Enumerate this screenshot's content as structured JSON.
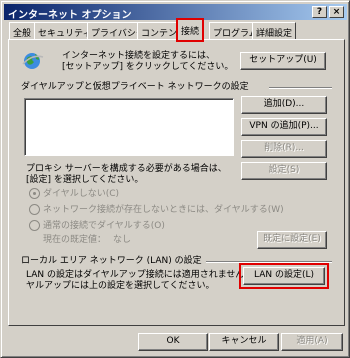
{
  "window": {
    "title": "インターネット オプション",
    "help_label": "?",
    "close_label": "×"
  },
  "tabs": [
    {
      "label": "全般"
    },
    {
      "label": "セキュリティ"
    },
    {
      "label": "プライバシー"
    },
    {
      "label": "コンテンツ"
    },
    {
      "label": "接続",
      "active": true
    },
    {
      "label": "プログラム"
    },
    {
      "label": "詳細設定"
    }
  ],
  "setup": {
    "text_line1": "インターネット接続を設定するには、",
    "text_line2": "[セットアップ] をクリックしてください。",
    "button_label": "セットアップ(U)"
  },
  "dialup": {
    "section_label": "ダイヤルアップと仮想プライベート ネットワークの設定",
    "add_label": "追加(D)...",
    "vpn_label": "VPN の追加(P)...",
    "delete_label": "削除(R)...",
    "settings_label": "設定(S)",
    "proxy_line1": "プロキシ サーバーを構成する必要がある場合は、",
    "proxy_line2": "[設定] を選択してください。",
    "radio_never": "ダイヤルしない(C)",
    "radio_when_none": "ネットワーク接続が存在しないときには、ダイヤルする(W)",
    "radio_always": "通常の接続でダイヤルする(O)",
    "current_default_label": "現在の既定値：",
    "current_default_value": "なし",
    "set_default_label": "既定に設定(E)"
  },
  "lan": {
    "section_label": "ローカル エリア ネットワーク (LAN) の設定",
    "text_line1": "LAN の設定はダイヤルアップ接続には適用されません。ダイ",
    "text_line2": "ヤルアップには上の設定を選択してください。",
    "button_label": "LAN の設定(L)"
  },
  "footer": {
    "ok_label": "OK",
    "cancel_label": "キャンセル",
    "apply_label": "適用(A)"
  },
  "colors": {
    "highlight": "#e00000",
    "titlebar": "#0a246a",
    "face": "#d4d0c8"
  }
}
